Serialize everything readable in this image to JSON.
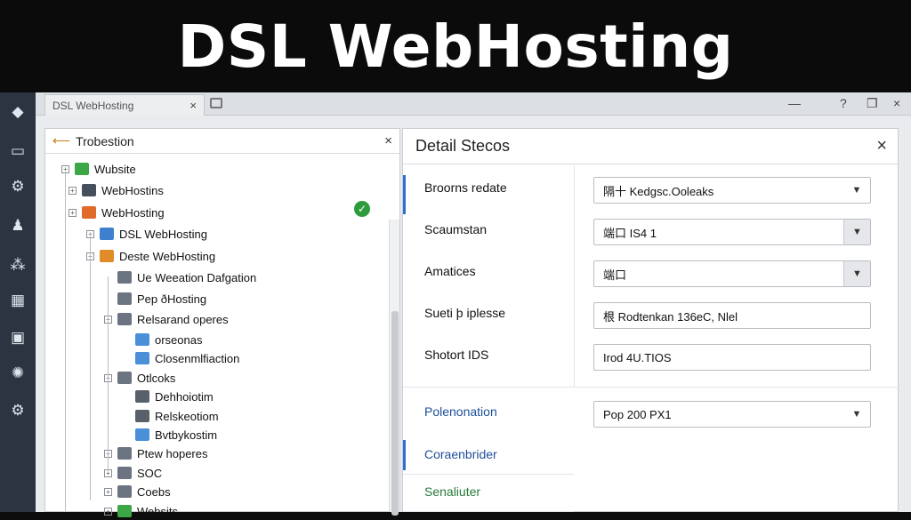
{
  "banner": {
    "title": "DSL WebHosting"
  },
  "tabbar": {
    "tab_label": "DSL WebHosting",
    "tab_close": "×"
  },
  "window_controls": {
    "minimize": "—",
    "help": "?",
    "restore": "❐",
    "close": "×"
  },
  "tree": {
    "title": "Trobestion",
    "close": "×",
    "nodes": [
      {
        "label": "Wubsite",
        "icon_color": "#3ba745",
        "expander": "+"
      },
      {
        "label": "WebHostins",
        "icon_color": "#46505c",
        "expander": "+"
      },
      {
        "label": "WebHosting",
        "icon_color": "#e06a2a",
        "expander": "+"
      },
      {
        "label": "DSL WebHosting",
        "icon_color": "#3f7fcf",
        "expander": "+"
      },
      {
        "label": "Deste WebHosting",
        "icon_color": "#e08a2a",
        "expander": "−"
      },
      {
        "label": "Ue Weeation Dafgation",
        "icon_color": "#6b7480",
        "expander": ""
      },
      {
        "label": "Pep ðHosting",
        "icon_color": "#6b7480",
        "expander": ""
      },
      {
        "label": "Relsarand operes",
        "icon_color": "#6b7480",
        "expander": "+"
      },
      {
        "label": "orseonas",
        "icon_color": "#4a8fd8",
        "expander": ""
      },
      {
        "label": "Closenmlfiaction",
        "icon_color": "#4a8fd8",
        "expander": ""
      },
      {
        "label": "Otlcoks",
        "icon_color": "#6b7480",
        "expander": "+"
      },
      {
        "label": "Dehhoiotim",
        "icon_color": "#58606a",
        "expander": ""
      },
      {
        "label": "Relskeotiom",
        "icon_color": "#58606a",
        "expander": ""
      },
      {
        "label": "Bvtbykostim",
        "icon_color": "#4a8fd8",
        "expander": ""
      },
      {
        "label": "Ptew hoperes",
        "icon_color": "#6b7480",
        "expander": "+"
      },
      {
        "label": "SOC",
        "icon_color": "#6b7480",
        "expander": "+"
      },
      {
        "label": "Coebs",
        "icon_color": "#6b7480",
        "expander": "+"
      },
      {
        "label": "Websits",
        "icon_color": "#3ba745",
        "expander": "+"
      }
    ]
  },
  "details": {
    "title": "Detail Stecos",
    "close": "×",
    "rows": [
      {
        "label": "Broorns redate",
        "value": "隔十 Kedgsc.Ooleaks",
        "control": "dropdown"
      },
      {
        "label": "Scaumstan",
        "value": "端口 IS4 1",
        "control": "dropdown-gray"
      },
      {
        "label": "Amatices",
        "value": "端口",
        "control": "dropdown-gray"
      },
      {
        "label": "Sueti þ iplesse",
        "value": "根 Rodtenkan 136eC, Nlel",
        "control": "text"
      },
      {
        "label": "Shotort IDS",
        "value": "Irod 4U.TIOS",
        "control": "text"
      },
      {
        "label": "Polenonation",
        "value": "Pop 200 PX1",
        "control": "dropdown"
      },
      {
        "label": "Coraenbrider",
        "value": "",
        "control": "none"
      },
      {
        "label": "Senaliuter",
        "value": "",
        "control": "none"
      }
    ]
  },
  "colors": {
    "rail": "#2b3440",
    "accent": "#2d6fd1",
    "ok": "#2e9c3c"
  },
  "icons": {
    "ok": "check-icon"
  }
}
